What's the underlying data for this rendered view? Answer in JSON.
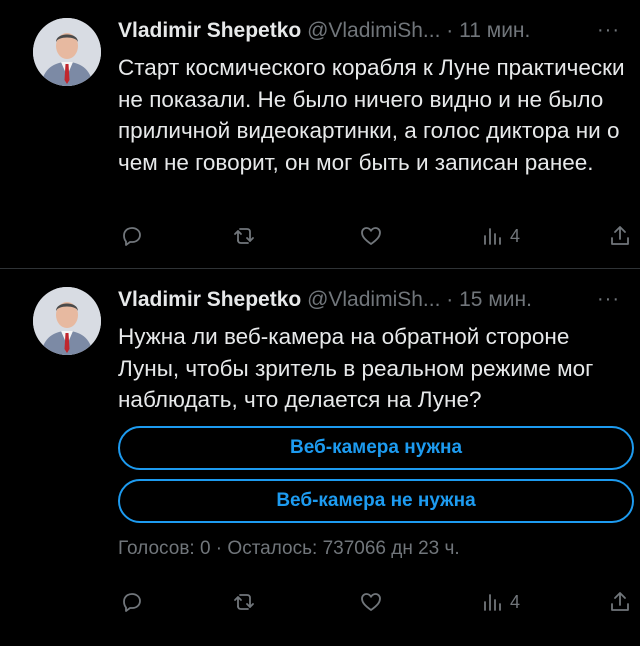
{
  "colors": {
    "background": "#000000",
    "text": "#e7e9ea",
    "muted": "#71767b",
    "accent": "#1d9bf0"
  },
  "tweets": [
    {
      "author_name": "Vladimir Shepetko",
      "author_handle": "@VladimiSh...",
      "dot": "·",
      "time": "11 мин.",
      "more": "···",
      "text": "Старт космического корабля к Луне практически не показали. Не было ничего видно и не было приличной видеокартинки, а голос диктора ни о чем не говорит, он мог быть и записан ранее.",
      "views_count": "4"
    },
    {
      "author_name": "Vladimir Shepetko",
      "author_handle": "@VladimiSh...",
      "dot": "·",
      "time": "15 мин.",
      "more": "···",
      "text": "Нужна ли веб-камера на обратной стороне Луны, чтобы зритель в реальном режиме мог наблюдать, что делается на Луне?",
      "poll": {
        "options": [
          "Веб-камера нужна",
          "Веб-камера не нужна"
        ],
        "meta": "Голосов: 0 · Осталось: 737066 дн 23 ч."
      },
      "views_count": "4"
    }
  ],
  "icons": [
    "reply-icon",
    "retweet-icon",
    "like-icon",
    "views-icon",
    "share-icon",
    "more-icon"
  ]
}
